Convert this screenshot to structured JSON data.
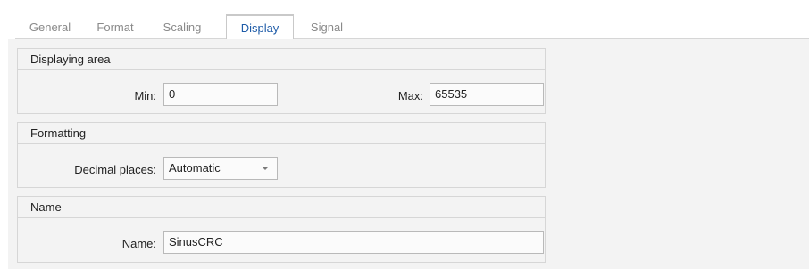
{
  "tabs": [
    {
      "label": "General"
    },
    {
      "label": "Format"
    },
    {
      "label": "Scaling"
    },
    {
      "label": "Display",
      "active": true
    },
    {
      "label": "Signal"
    }
  ],
  "groups": {
    "displaying_area": {
      "title": "Displaying area",
      "min_label": "Min:",
      "min_value": "0",
      "max_label": "Max:",
      "max_value": "65535"
    },
    "formatting": {
      "title": "Formatting",
      "decimal_label": "Decimal places:",
      "decimal_value": "Automatic"
    },
    "name": {
      "title": "Name",
      "name_label": "Name:",
      "name_value": "SinusCRC"
    }
  },
  "colors": {
    "active_tab_text": "#1f5ca8",
    "panel_background": "#f3f3f3",
    "border": "#d6d6d6"
  },
  "icons": {
    "dropdown": "chevron-down-icon"
  }
}
